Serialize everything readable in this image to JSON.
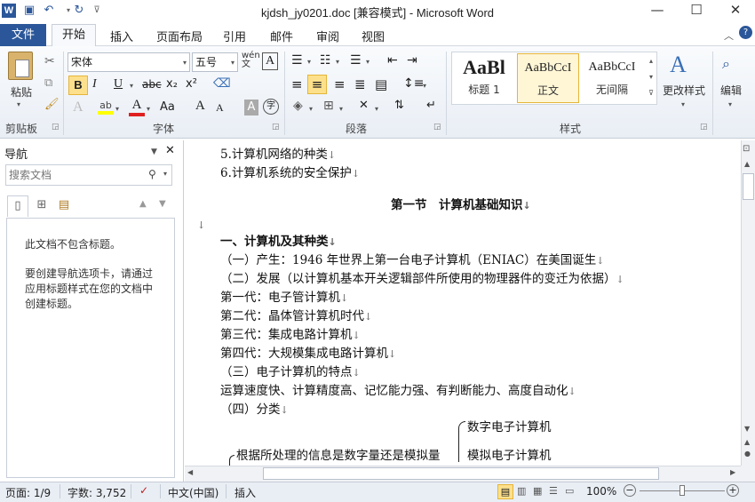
{
  "window": {
    "title": "kjdsh_jy0201.doc [兼容模式] - Microsoft Word",
    "app_icon": "W"
  },
  "tabs": {
    "file": "文件",
    "home": "开始",
    "insert": "插入",
    "layout": "页面布局",
    "references": "引用",
    "mailings": "邮件",
    "review": "审阅",
    "view": "视图"
  },
  "ribbon": {
    "clipboard": {
      "label": "剪贴板",
      "paste": "粘贴"
    },
    "font": {
      "label": "字体",
      "name": "宋体",
      "size": "五号",
      "bold": "B",
      "italic": "I",
      "underline": "U",
      "strike": "abc",
      "sub": "x₂",
      "sup": "x²",
      "wen": "wén",
      "font_color_letter": "A",
      "grow": "A",
      "shrink": "A",
      "aa": "Aa"
    },
    "paragraph": {
      "label": "段落"
    },
    "styles": {
      "label": "样式",
      "items": [
        {
          "preview": "AaBl",
          "name": "标题 1"
        },
        {
          "preview": "AaBbCcI",
          "name": "正文"
        },
        {
          "preview": "AaBbCcI",
          "name": "无间隔"
        }
      ],
      "change": "更改样式"
    },
    "editing": {
      "label": "编辑"
    }
  },
  "nav": {
    "title": "导航",
    "search_placeholder": "搜索文档",
    "msg1": "此文档不包含标题。",
    "msg2": "要创建导航选项卡，请通过应用标题样式在您的文档中创建标题。"
  },
  "doc": {
    "lines": [
      "5.计算机网络的种类",
      "6.计算机系统的安全保护",
      "第一节　计算机基础知识",
      "一、计算机及其种类",
      "（一）产生：1946 年世界上第一台电子计算机（ENIAC）在美国诞生",
      "（二）发展（以计算机基本开关逻辑部件所使用的物理器件的变迁为依据）",
      "第一代：电子管计算机",
      "第二代：晶体管计算机时代",
      "第三代：集成电路计算机",
      "第四代：大规模集成电路计算机",
      "（三）电子计算机的特点",
      "运算速度快、计算精度高、记忆能力强、有判断能力、高度自动化",
      "（四）分类"
    ],
    "branch_left": "根据所处理的信息是数字量还是模拟量",
    "branch_a": "数字电子计算机",
    "branch_b": "模拟电子计算机",
    "para_mark": "↓"
  },
  "status": {
    "page": "页面: 1/9",
    "words": "字数: 3,752",
    "lang": "中文(中国)",
    "mode": "插入",
    "zoom": "100%"
  },
  "colors": {
    "accent": "#2b579a"
  }
}
